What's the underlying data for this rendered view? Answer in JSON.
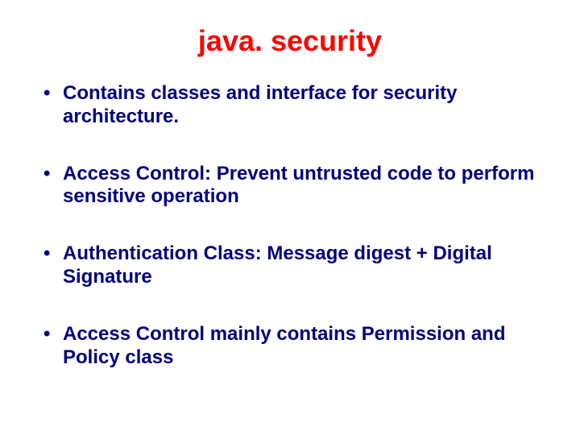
{
  "title": "java. security",
  "bullets": [
    "Contains classes and interface for security architecture.",
    "Access Control: Prevent untrusted code to perform sensitive operation",
    "Authentication Class: Message digest + Digital Signature",
    "Access Control mainly contains Permission and Policy class"
  ],
  "colors": {
    "title": "#ff0000",
    "body": "#000080",
    "background": "#ffffff"
  }
}
